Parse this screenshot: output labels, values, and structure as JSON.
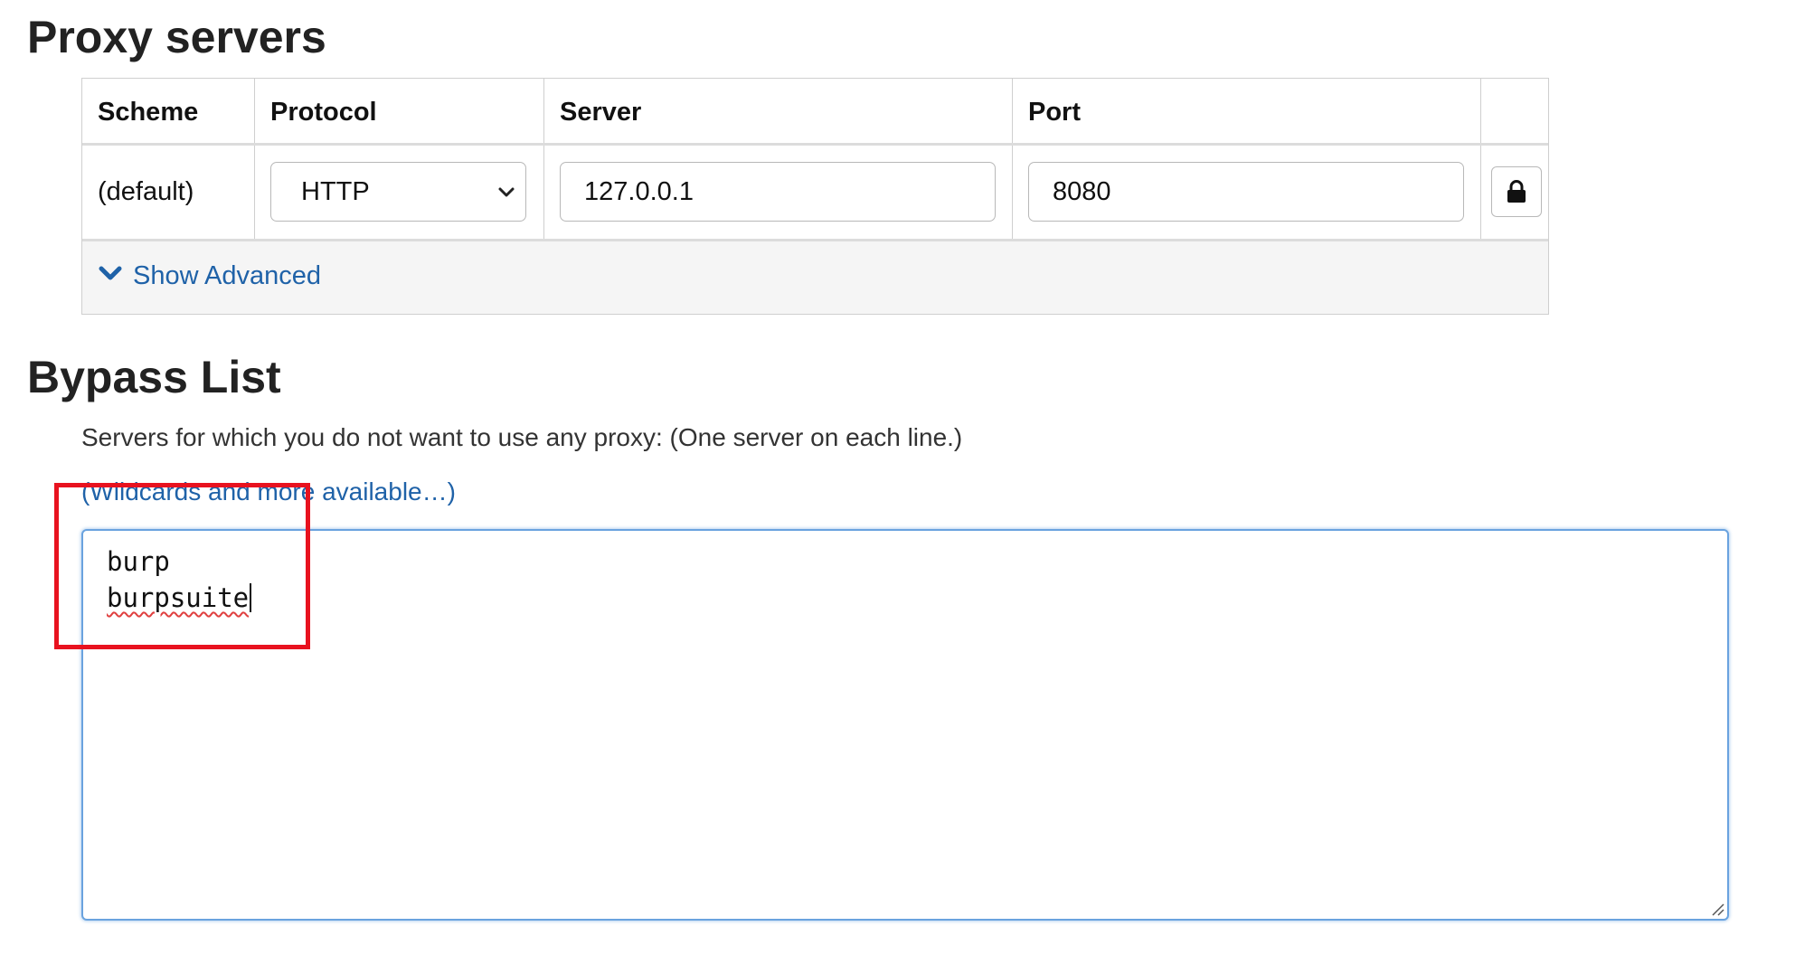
{
  "proxy_servers": {
    "title": "Proxy servers",
    "table": {
      "headers": [
        "Scheme",
        "Protocol",
        "Server",
        "Port",
        ""
      ],
      "row": {
        "scheme": "(default)",
        "protocol": "HTTP",
        "server": "127.0.0.1",
        "port": "8080",
        "lock_icon": "lock-icon"
      }
    },
    "show_advanced": {
      "label": "Show Advanced",
      "icon": "chevron-down-icon"
    }
  },
  "bypass_list": {
    "title": "Bypass List",
    "description": "Servers for which you do not want to use any proxy: (One server on each line.)",
    "wildcards_link": "(Wildcards and more available…)",
    "entries": [
      "burp",
      "burpsuite"
    ]
  },
  "colors": {
    "link": "#1f62a8",
    "highlight": "#e8121f",
    "focus_border": "#6aa3df",
    "advanced_row_background": "#f5f5f5"
  }
}
